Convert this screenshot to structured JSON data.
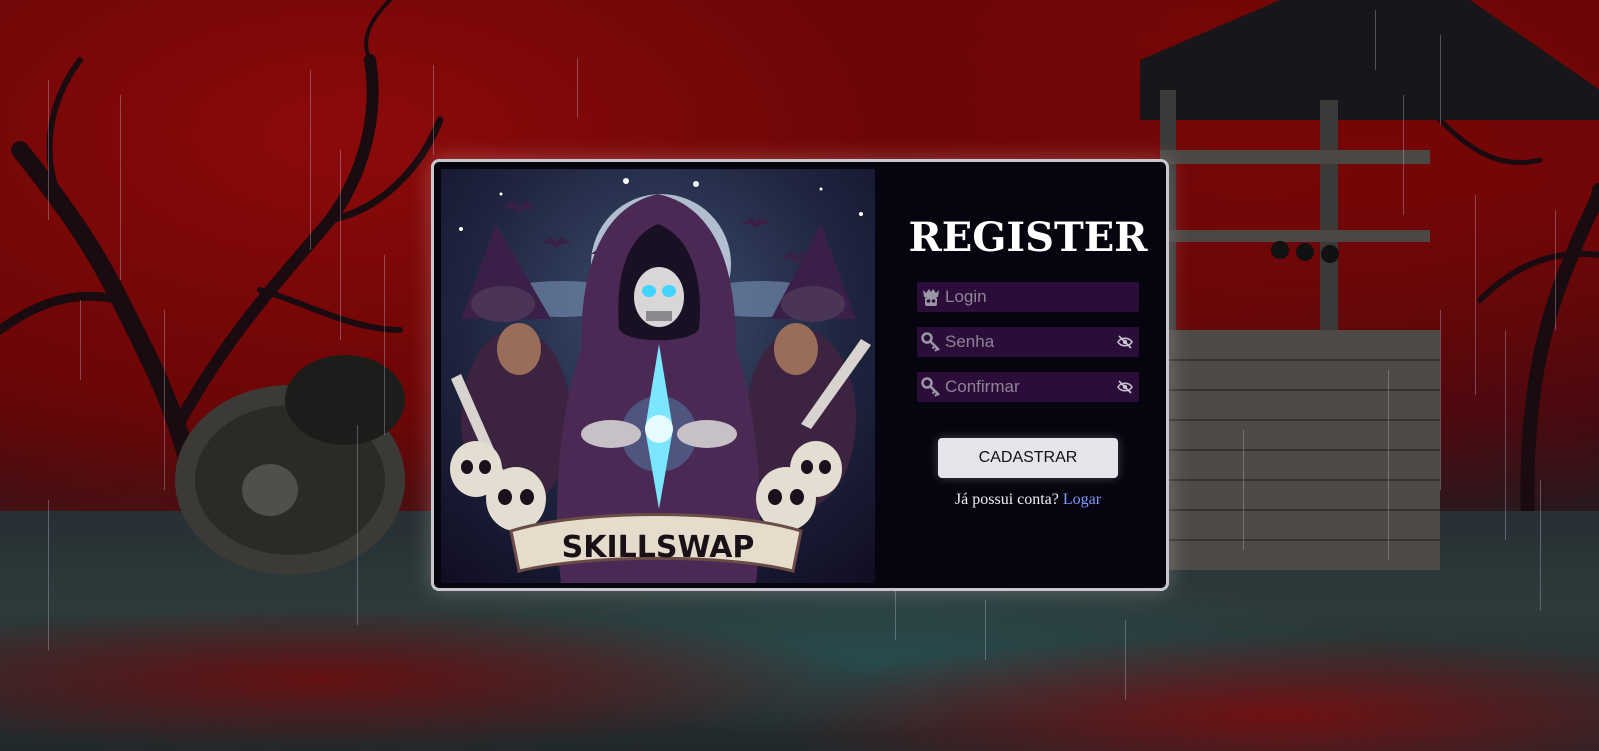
{
  "register": {
    "title": "REGISTER",
    "login_placeholder": "Login",
    "password_placeholder": "Senha",
    "confirm_placeholder": "Confirmar",
    "submit_label": "CADASTRAR",
    "has_account_text": "Já possui conta?",
    "login_link_label": "Logar"
  },
  "art": {
    "logo_text": "SKILLSWAP"
  },
  "icons": {
    "login_field": "crown-skull-icon",
    "password_field": "key-icon",
    "confirm_field": "key-icon",
    "toggle_visibility": "eye-slash-icon"
  },
  "colors": {
    "modal_background": "#06040f",
    "input_background": "#2a0d39",
    "button_background": "#e6e4ea",
    "link": "#7e9bff"
  }
}
